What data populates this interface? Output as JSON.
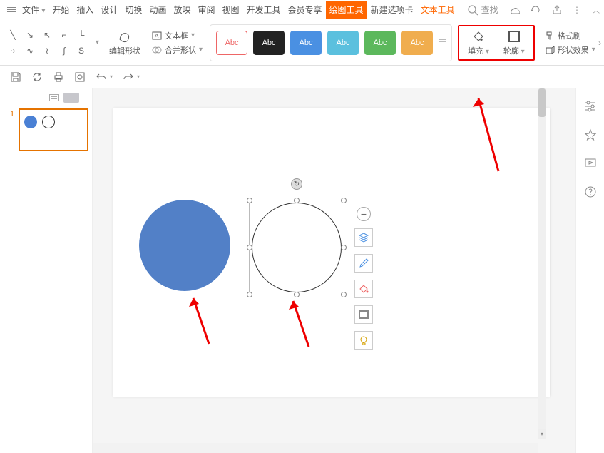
{
  "menu": {
    "file": "文件",
    "start": "开始",
    "insert": "插入",
    "design": "设计",
    "transition": "切换",
    "animation": "动画",
    "slideshow": "放映",
    "review": "审阅",
    "view": "视图",
    "devtools": "开发工具",
    "member": "会员专享",
    "drawtools": "绘图工具",
    "newtab": "新建选项卡",
    "texttools": "文本工具",
    "search_placeholder": "查找"
  },
  "ribbon": {
    "edit_shape": "编辑形状",
    "textbox": "文本框",
    "merge_shapes": "合并形状",
    "swatch_label": "Abc",
    "fill": "填充",
    "outline": "轮廓",
    "format_painter": "格式刷",
    "shape_effects": "形状效果"
  },
  "thumb": {
    "num": "1"
  },
  "float": {
    "minus": "−",
    "layers": "≣",
    "pencil": "✎",
    "bucket": "◇",
    "rect": "▭",
    "bulb": "◉"
  }
}
